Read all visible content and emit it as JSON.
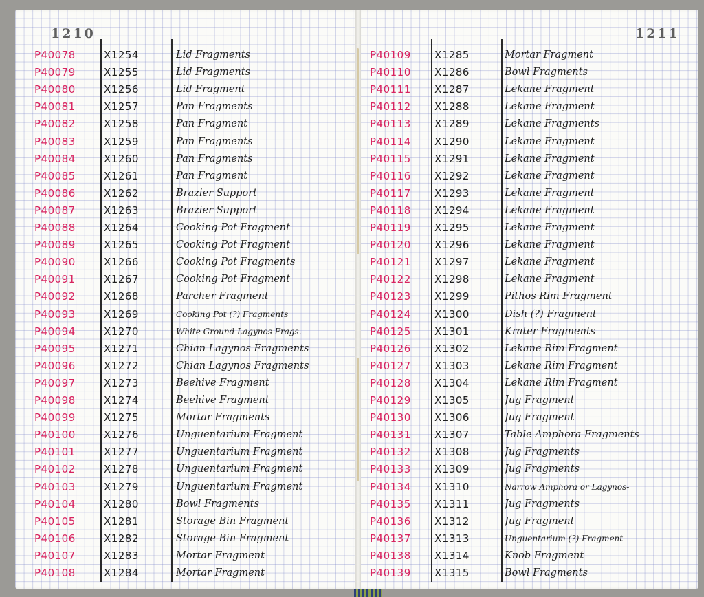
{
  "left_page": {
    "number": "1210",
    "rows": [
      {
        "p": "P40078",
        "x": "X1254",
        "desc": "Lid Fragments"
      },
      {
        "p": "P40079",
        "x": "X1255",
        "desc": "Lid Fragments"
      },
      {
        "p": "P40080",
        "x": "X1256",
        "desc": "Lid Fragment"
      },
      {
        "p": "P40081",
        "x": "X1257",
        "desc": "Pan Fragments"
      },
      {
        "p": "P40082",
        "x": "X1258",
        "desc": "Pan Fragment"
      },
      {
        "p": "P40083",
        "x": "X1259",
        "desc": "Pan Fragments"
      },
      {
        "p": "P40084",
        "x": "X1260",
        "desc": "Pan Fragments"
      },
      {
        "p": "P40085",
        "x": "X1261",
        "desc": "Pan Fragment"
      },
      {
        "p": "P40086",
        "x": "X1262",
        "desc": "Brazier Support"
      },
      {
        "p": "P40087",
        "x": "X1263",
        "desc": "Brazier Support"
      },
      {
        "p": "P40088",
        "x": "X1264",
        "desc": "Cooking Pot Fragment"
      },
      {
        "p": "P40089",
        "x": "X1265",
        "desc": "Cooking Pot Fragment"
      },
      {
        "p": "P40090",
        "x": "X1266",
        "desc": "Cooking Pot Fragments"
      },
      {
        "p": "P40091",
        "x": "X1267",
        "desc": "Cooking Pot Fragment"
      },
      {
        "p": "P40092",
        "x": "X1268",
        "desc": "Parcher Fragment"
      },
      {
        "p": "P40093",
        "x": "X1269",
        "desc": "Cooking Pot (?) Fragments"
      },
      {
        "p": "P40094",
        "x": "X1270",
        "desc": "White Ground Lagynos Frags."
      },
      {
        "p": "P40095",
        "x": "X1271",
        "desc": "Chian Lagynos Fragments"
      },
      {
        "p": "P40096",
        "x": "X1272",
        "desc": "Chian Lagynos Fragments"
      },
      {
        "p": "P40097",
        "x": "X1273",
        "desc": "Beehive Fragment"
      },
      {
        "p": "P40098",
        "x": "X1274",
        "desc": "Beehive Fragment"
      },
      {
        "p": "P40099",
        "x": "X1275",
        "desc": "Mortar Fragments"
      },
      {
        "p": "P40100",
        "x": "X1276",
        "desc": "Unguentarium Fragment"
      },
      {
        "p": "P40101",
        "x": "X1277",
        "desc": "Unguentarium Fragment"
      },
      {
        "p": "P40102",
        "x": "X1278",
        "desc": "Unguentarium Fragment"
      },
      {
        "p": "P40103",
        "x": "X1279",
        "desc": "Unguentarium Fragment"
      },
      {
        "p": "P40104",
        "x": "X1280",
        "desc": "Bowl Fragments"
      },
      {
        "p": "P40105",
        "x": "X1281",
        "desc": "Storage Bin Fragment"
      },
      {
        "p": "P40106",
        "x": "X1282",
        "desc": "Storage Bin Fragment"
      },
      {
        "p": "P40107",
        "x": "X1283",
        "desc": "Mortar Fragment"
      },
      {
        "p": "P40108",
        "x": "X1284",
        "desc": "Mortar Fragment"
      }
    ]
  },
  "right_page": {
    "number": "1211",
    "rows": [
      {
        "p": "P40109",
        "x": "X1285",
        "desc": "Mortar Fragment"
      },
      {
        "p": "P40110",
        "x": "X1286",
        "desc": "Bowl Fragments"
      },
      {
        "p": "P40111",
        "x": "X1287",
        "desc": "Lekane Fragment"
      },
      {
        "p": "P40112",
        "x": "X1288",
        "desc": "Lekane Fragment"
      },
      {
        "p": "P40113",
        "x": "X1289",
        "desc": "Lekane Fragments"
      },
      {
        "p": "P40114",
        "x": "X1290",
        "desc": "Lekane Fragment"
      },
      {
        "p": "P40115",
        "x": "X1291",
        "desc": "Lekane Fragment"
      },
      {
        "p": "P40116",
        "x": "X1292",
        "desc": "Lekane Fragment"
      },
      {
        "p": "P40117",
        "x": "X1293",
        "desc": "Lekane Fragment"
      },
      {
        "p": "P40118",
        "x": "X1294",
        "desc": "Lekane Fragment"
      },
      {
        "p": "P40119",
        "x": "X1295",
        "desc": "Lekane Fragment"
      },
      {
        "p": "P40120",
        "x": "X1296",
        "desc": "Lekane Fragment"
      },
      {
        "p": "P40121",
        "x": "X1297",
        "desc": "Lekane Fragment"
      },
      {
        "p": "P40122",
        "x": "X1298",
        "desc": "Lekane Fragment"
      },
      {
        "p": "P40123",
        "x": "X1299",
        "desc": "Pithos Rim Fragment"
      },
      {
        "p": "P40124",
        "x": "X1300",
        "desc": "Dish (?) Fragment"
      },
      {
        "p": "P40125",
        "x": "X1301",
        "desc": "Krater Fragments"
      },
      {
        "p": "P40126",
        "x": "X1302",
        "desc": "Lekane Rim Fragment"
      },
      {
        "p": "P40127",
        "x": "X1303",
        "desc": "Lekane Rim Fragment"
      },
      {
        "p": "P40128",
        "x": "X1304",
        "desc": "Lekane Rim Fragment"
      },
      {
        "p": "P40129",
        "x": "X1305",
        "desc": "Jug Fragment"
      },
      {
        "p": "P40130",
        "x": "X1306",
        "desc": "Jug Fragment"
      },
      {
        "p": "P40131",
        "x": "X1307",
        "desc": "Table Amphora Fragments"
      },
      {
        "p": "P40132",
        "x": "X1308",
        "desc": "Jug Fragments"
      },
      {
        "p": "P40133",
        "x": "X1309",
        "desc": "Jug Fragments"
      },
      {
        "p": "P40134",
        "x": "X1310",
        "desc": "Narrow Amphora or Lagynos-"
      },
      {
        "p": "P40135",
        "x": "X1311",
        "desc": "Jug Fragments"
      },
      {
        "p": "P40136",
        "x": "X1312",
        "desc": "Jug Fragment"
      },
      {
        "p": "P40137",
        "x": "X1313",
        "desc": "Unguentarium (?) Fragment"
      },
      {
        "p": "P40138",
        "x": "X1314",
        "desc": "Knob Fragment"
      },
      {
        "p": "P40139",
        "x": "X1315",
        "desc": "Bowl Fragments"
      }
    ]
  }
}
